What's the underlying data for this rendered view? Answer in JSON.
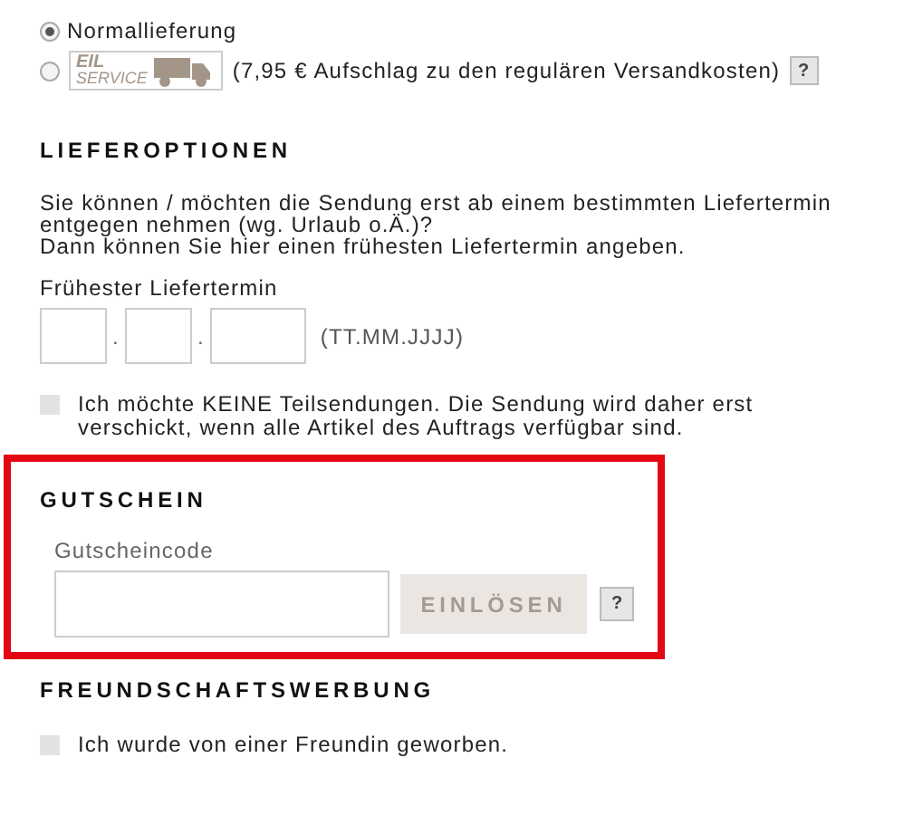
{
  "delivery_options": [
    {
      "kind": "normal",
      "label": "Normallieferung",
      "selected": true
    },
    {
      "kind": "express",
      "logo_top": "EIL",
      "logo_bottom": "SERVICE",
      "label": "(7,95 € Aufschlag zu den regulären Versandkosten)",
      "help": "?",
      "selected": false
    }
  ],
  "lieferoptionen": {
    "heading": "LIEFEROPTIONEN",
    "paragraphs": [
      "Sie können / möchten die Sendung erst ab einem bestimmten Liefertermin entgegen nehmen (wg. Urlaub o.Ä.)?",
      "Dann können Sie hier einen frühesten Liefertermin angeben."
    ],
    "date_label": "Frühester Liefertermin",
    "date_separators": [
      ".",
      "."
    ],
    "date_format": "(TT.MM.JJJJ)",
    "partial": {
      "checked": false,
      "label": "Ich möchte KEINE Teilsendungen. Die Sendung wird daher erst verschickt, wenn alle Artikel des Auftrags verfügbar sind."
    }
  },
  "gutschein": {
    "highlighted": true,
    "heading": "GUTSCHEIN",
    "field_label": "Gutscheincode",
    "button": "EINLÖSEN",
    "help": "?"
  },
  "freundschaft": {
    "heading": "FREUNDSCHAFTSWERBUNG",
    "referral": {
      "checked": false,
      "label": "Ich wurde von einer Freundin geworben."
    }
  }
}
